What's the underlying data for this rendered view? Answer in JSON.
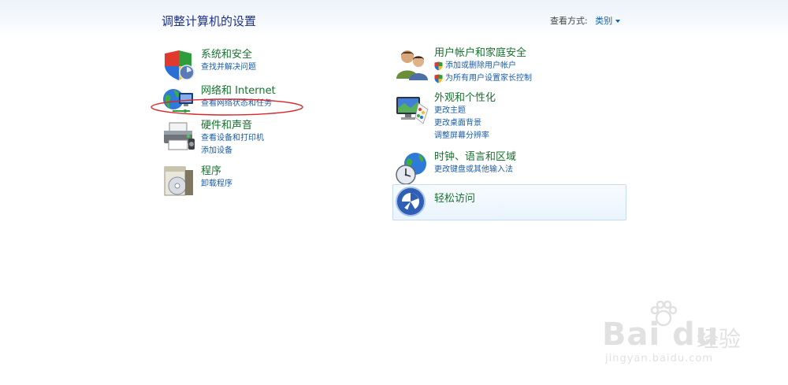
{
  "header": {
    "title": "调整计算机的设置",
    "view_by_label": "查看方式:",
    "view_by_value": "类别"
  },
  "left_categories": [
    {
      "title": "系统和安全",
      "icon": "security-shield-icon",
      "links": [
        "查找并解决问题"
      ]
    },
    {
      "title": "网络和 Internet",
      "icon": "network-globe-icon",
      "links": [
        "查看网络状态和任务"
      ]
    },
    {
      "title": "硬件和声音",
      "icon": "printer-icon",
      "links": [
        "查看设备和打印机",
        "添加设备"
      ]
    },
    {
      "title": "程序",
      "icon": "programs-cd-icon",
      "links": [
        "卸载程序"
      ]
    }
  ],
  "right_categories": [
    {
      "title": "用户帐户和家庭安全",
      "icon": "users-icon",
      "links": [
        "添加或删除用户帐户",
        "为所有用户设置家长控制"
      ],
      "shield_links": true
    },
    {
      "title": "外观和个性化",
      "icon": "monitor-palette-icon",
      "links": [
        "更改主题",
        "更改桌面背景",
        "调整屏幕分辨率"
      ]
    },
    {
      "title": "时钟、语言和区域",
      "icon": "clock-globe-icon",
      "links": [
        "更改键盘或其他输入法"
      ]
    },
    {
      "title": "轻松访问",
      "icon": "ease-of-access-icon",
      "links": []
    }
  ],
  "watermark": {
    "logo_text": "Bai du",
    "cn_text": "经验",
    "url": "jingyan.baidu.com"
  },
  "colors": {
    "title_blue": "#1e3287",
    "category_green": "#17722e",
    "link_blue": "#1a5ca8",
    "annotation_red": "#d8262a"
  }
}
